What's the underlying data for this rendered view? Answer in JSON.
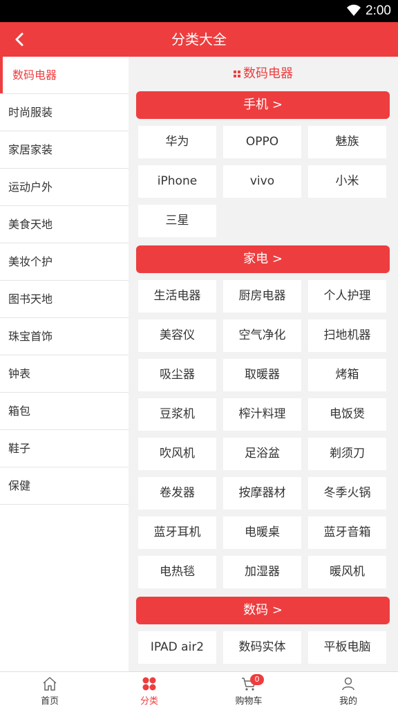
{
  "status_bar": {
    "time": "2:00",
    "wifi_icon": "wifi-icon"
  },
  "header": {
    "title": "分类大全",
    "back_icon": "back-icon"
  },
  "sidebar": {
    "items": [
      {
        "label": "数码电器",
        "active": true
      },
      {
        "label": "时尚服装"
      },
      {
        "label": "家居家装"
      },
      {
        "label": "运动户外"
      },
      {
        "label": "美食天地"
      },
      {
        "label": "美妆个护"
      },
      {
        "label": "图书天地"
      },
      {
        "label": "珠宝首饰"
      },
      {
        "label": "钟表"
      },
      {
        "label": "箱包"
      },
      {
        "label": "鞋子"
      },
      {
        "label": "保健"
      }
    ]
  },
  "content": {
    "title": "数码电器",
    "sections": [
      {
        "header": "手机 >",
        "items": [
          "华为",
          "OPPO",
          "魅族",
          "iPhone",
          "vivo",
          "小米",
          "三星"
        ]
      },
      {
        "header": "家电 >",
        "items": [
          "生活电器",
          "厨房电器",
          "个人护理",
          "美容仪",
          "空气净化",
          "扫地机器",
          "吸尘器",
          "取暖器",
          "烤箱",
          "豆浆机",
          "榨汁料理",
          "电饭煲",
          "吹风机",
          "足浴盆",
          "剃须刀",
          "卷发器",
          "按摩器材",
          "冬季火锅",
          "蓝牙耳机",
          "电暖桌",
          "蓝牙音箱",
          "电热毯",
          "加湿器",
          "暖风机"
        ]
      },
      {
        "header": "数码 >",
        "items": [
          "IPAD air2",
          "数码实体",
          "平板电脑"
        ]
      }
    ]
  },
  "tabbar": {
    "tabs": [
      {
        "label": "首页",
        "icon": "home-icon"
      },
      {
        "label": "分类",
        "icon": "category-icon",
        "active": true
      },
      {
        "label": "购物车",
        "icon": "cart-icon",
        "badge": "0"
      },
      {
        "label": "我的",
        "icon": "user-icon"
      }
    ]
  },
  "colors": {
    "accent": "#ee3d3f"
  }
}
